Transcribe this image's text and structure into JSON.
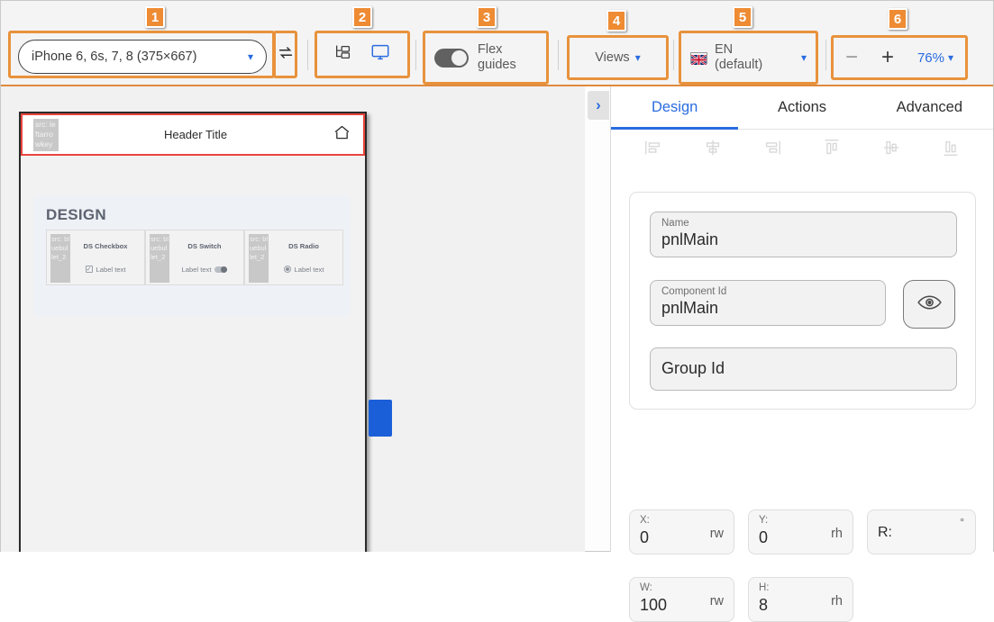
{
  "toolbar": {
    "badges": [
      "1",
      "2",
      "3",
      "4",
      "5",
      "6"
    ],
    "device": {
      "label": "iPhone 6, 6s, 7, 8 (375×667)",
      "chevron": "chevron-down-icon"
    },
    "rotate": {
      "icon": "rotate-swap-icon"
    },
    "view_icons": {
      "tree": "tree-structure-icon",
      "desktop": "desktop-monitor-icon"
    },
    "flex_guides": {
      "label_line1": "Flex",
      "label_line2": "guides",
      "state": "on"
    },
    "views": {
      "label": "Views",
      "chevron": "chevron-down-icon"
    },
    "language": {
      "line1": "EN",
      "line2": "(default)",
      "flag": "uk-flag-icon",
      "chevron": "chevron-down-icon"
    },
    "zoom": {
      "minus": "−",
      "plus": "+",
      "value": "76%",
      "chevron": "chevron-down-icon"
    }
  },
  "canvas": {
    "header": {
      "image_alt": "src: leftarrowkey",
      "title": "Header Title",
      "home_icon": "home-icon"
    },
    "design": {
      "title": "DESIGN",
      "cards": [
        {
          "image_alt": "src: bluebullet_2",
          "title": "DS Checkbox",
          "label": "Label text",
          "control": "checkbox"
        },
        {
          "image_alt": "src: bluebullet_2",
          "title": "DS Switch",
          "label": "Label text",
          "control": "switch"
        },
        {
          "image_alt": "src: bluebullet_2",
          "title": "DS Radio",
          "label": "Label text",
          "control": "radio"
        }
      ]
    }
  },
  "panel": {
    "collapse": "chevron-right-icon",
    "tabs": [
      {
        "label": "Design",
        "active": true
      },
      {
        "label": "Actions",
        "active": false
      },
      {
        "label": "Advanced",
        "active": false
      }
    ],
    "align_icons": [
      "align-left-icon",
      "align-center-horizontal-icon",
      "align-right-icon",
      "align-top-icon",
      "align-center-vertical-icon",
      "align-bottom-icon"
    ],
    "properties": {
      "name": {
        "caption": "Name",
        "value": "pnlMain"
      },
      "component_id": {
        "caption": "Component Id",
        "value": "pnlMain"
      },
      "visibility_button": "eye-icon",
      "group_id": {
        "placeholder": "Group Id"
      }
    },
    "geometry": [
      {
        "caption": "X:",
        "value": "0",
        "unit": "rw"
      },
      {
        "caption": "Y:",
        "value": "0",
        "unit": "rh"
      },
      {
        "caption": "W:",
        "value": "100",
        "unit": "rw"
      },
      {
        "caption": "H:",
        "value": "8",
        "unit": "rh"
      }
    ],
    "rotation": {
      "caption": "R:",
      "value": "",
      "unit": "°"
    }
  }
}
